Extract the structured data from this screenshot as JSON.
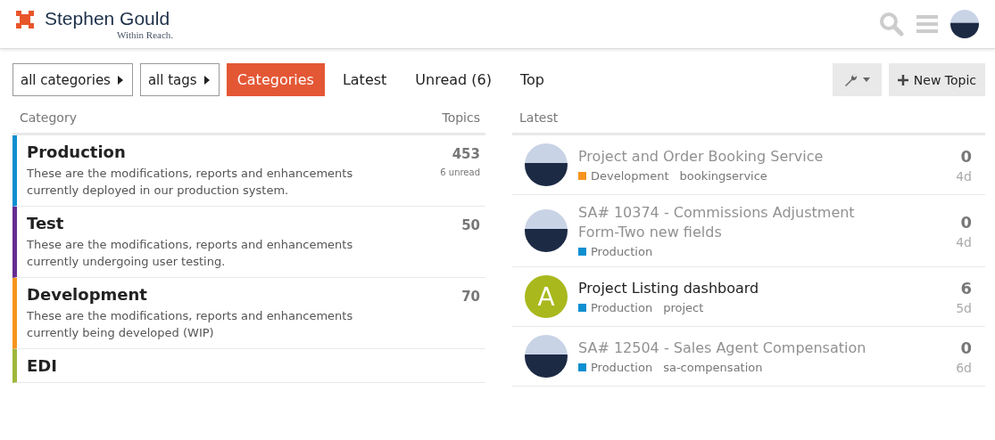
{
  "header": {
    "brand": "Stephen Gould",
    "tagline": "Within Reach."
  },
  "nav": {
    "filters": [
      {
        "label": "all categories"
      },
      {
        "label": "all tags"
      }
    ],
    "tabs": [
      {
        "label": "Categories",
        "selected": true
      },
      {
        "label": "Latest",
        "selected": false
      },
      {
        "label": "Unread (6)",
        "selected": false
      },
      {
        "label": "Top",
        "selected": false
      }
    ],
    "new_topic": "New Topic"
  },
  "categories": {
    "columns": [
      "Category",
      "Topics"
    ],
    "rows": [
      {
        "name": "Production",
        "color": "#0e8fd0",
        "description": "These are the modifications, reports and enhancements currently deployed in our production system.",
        "topics": "453",
        "unread": "6 unread"
      },
      {
        "name": "Test",
        "color": "#652d90",
        "description": "These are the modifications, reports and enhancements currently undergoing user testing.",
        "topics": "50"
      },
      {
        "name": "Development",
        "color": "#f7941d",
        "description": "These are the modifications, reports and enhancements currently being developed (WIP)",
        "topics": "70"
      },
      {
        "name": "EDI",
        "color": "#9eb83b"
      }
    ]
  },
  "latest": {
    "heading": "Latest",
    "topics": [
      {
        "title": "Project and Order Booking Service",
        "unread": false,
        "avatar": {
          "kind": "photo"
        },
        "category": {
          "name": "Development",
          "color": "#f7941d"
        },
        "tags": [
          "bookingservice"
        ],
        "replies": "0",
        "age": "4d"
      },
      {
        "title": "SA# 10374 - Commissions Adjustment Form-Two new fields",
        "unread": false,
        "avatar": {
          "kind": "photo"
        },
        "category": {
          "name": "Production",
          "color": "#0e8fd0"
        },
        "replies": "0",
        "age": "4d"
      },
      {
        "title": "Project Listing dashboard",
        "unread": true,
        "avatar": {
          "kind": "letter",
          "letter": "A",
          "color": "#a9b81c"
        },
        "category": {
          "name": "Production",
          "color": "#0e8fd0"
        },
        "tags": [
          "project"
        ],
        "replies": "6",
        "age": "5d"
      },
      {
        "title": "SA# 12504 - Sales Agent Compensation",
        "unread": false,
        "avatar": {
          "kind": "photo"
        },
        "category": {
          "name": "Production",
          "color": "#0e8fd0"
        },
        "tags": [
          "sa-compensation"
        ],
        "replies": "0",
        "age": "6d"
      }
    ]
  }
}
